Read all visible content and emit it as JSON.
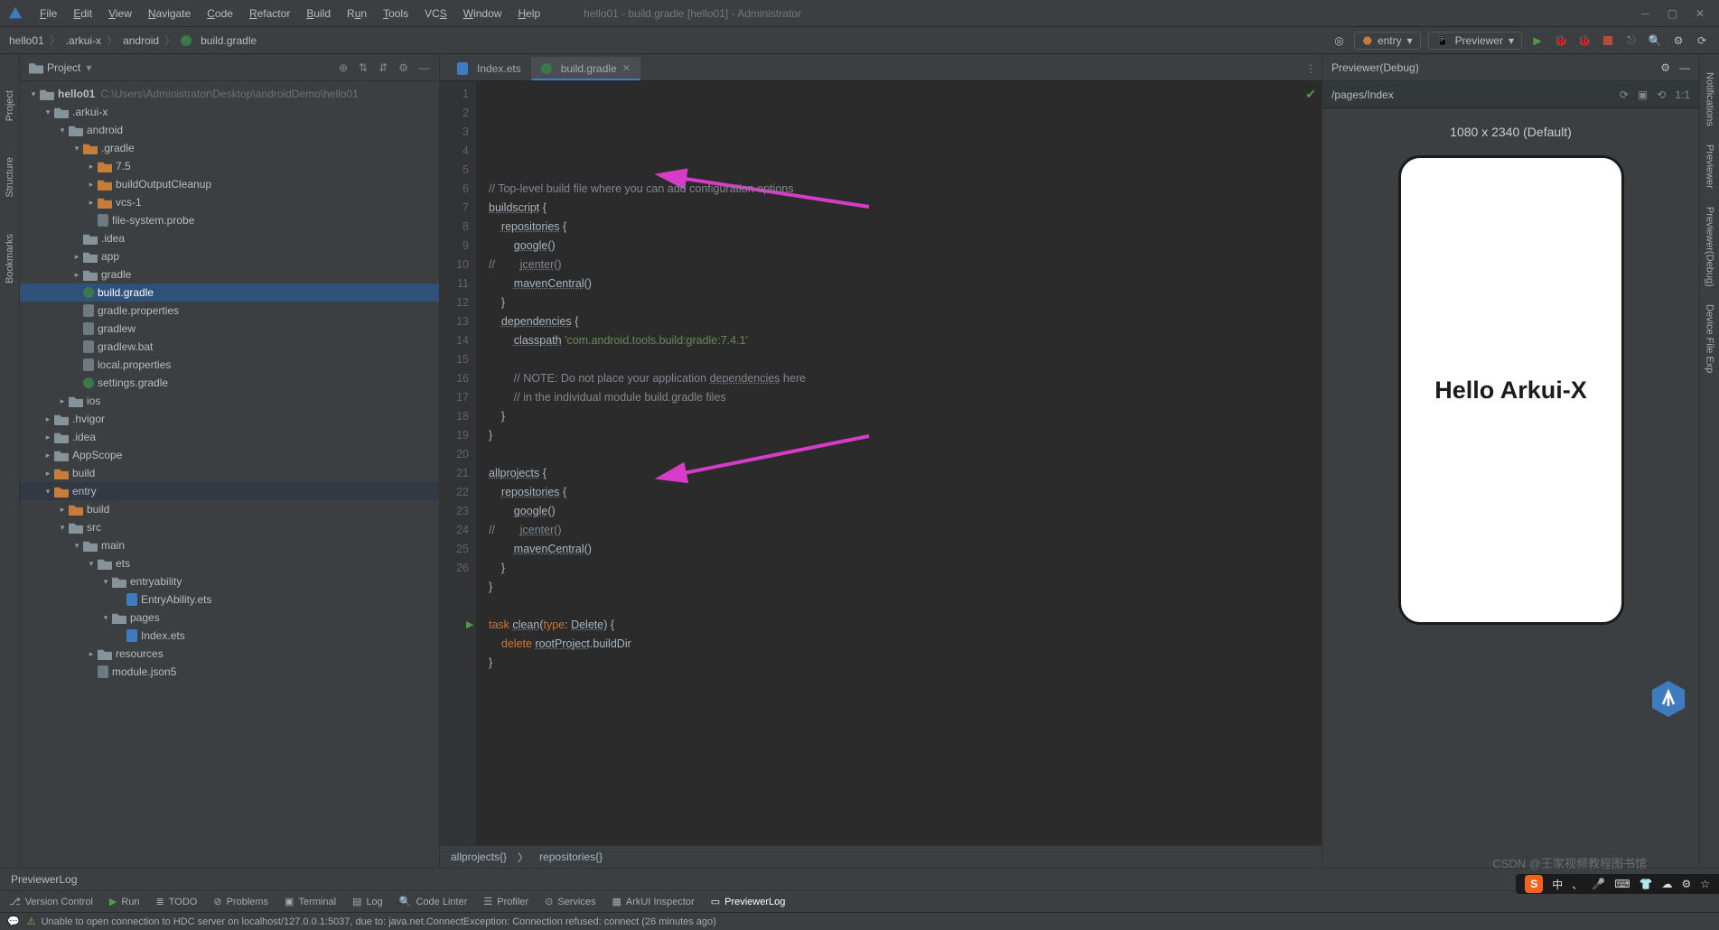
{
  "window": {
    "title": "hello01 - build.gradle [hello01] - Administrator"
  },
  "menu": [
    "File",
    "Edit",
    "View",
    "Navigate",
    "Code",
    "Refactor",
    "Build",
    "Run",
    "Tools",
    "VCS",
    "Window",
    "Help"
  ],
  "breadcrumb": [
    "hello01",
    ".arkui-x",
    "android",
    "build.gradle"
  ],
  "runConfig": {
    "entry": "entry",
    "previewer": "Previewer"
  },
  "project": {
    "label": "Project",
    "rootName": "hello01",
    "rootPath": "C:\\Users\\Administrator\\Desktop\\androidDemo\\hello01",
    "tree": [
      ".arkui-x",
      "android",
      ".gradle",
      "7.5",
      "buildOutputCleanup",
      "vcs-1",
      "file-system.probe",
      ".idea",
      "app",
      "gradle",
      "build.gradle",
      "gradle.properties",
      "gradlew",
      "gradlew.bat",
      "local.properties",
      "settings.gradle",
      "ios",
      ".hvigor",
      ".idea",
      "AppScope",
      "build",
      "entry",
      "build",
      "src",
      "main",
      "ets",
      "entryability",
      "EntryAbility.ets",
      "pages",
      "Index.ets",
      "resources",
      "module.json5"
    ]
  },
  "tabs": [
    {
      "icon": "ets",
      "label": "Index.ets",
      "active": false
    },
    {
      "icon": "gradle",
      "label": "build.gradle",
      "active": true
    }
  ],
  "code": {
    "lines": [
      "// Top-level build file where you can add configuration options ",
      "buildscript {",
      "    repositories {",
      "        google()",
      "//        jcenter()",
      "        mavenCentral()",
      "    }",
      "    dependencies {",
      "        classpath 'com.android.tools.build:gradle:7.4.1'",
      "",
      "        // NOTE: Do not place your application dependencies here",
      "        // in the individual module build.gradle files",
      "    }",
      "}",
      "",
      "allprojects {",
      "    repositories {",
      "        google()",
      "//        jcenter()",
      "        mavenCentral()",
      "    }",
      "}",
      "",
      "task clean(type: Delete) {",
      "    delete rootProject.buildDir",
      "}"
    ]
  },
  "editorCrumb": [
    "allprojects{}",
    "repositories{}"
  ],
  "previewer": {
    "header": "Previewer(Debug)",
    "page": "/pages/Index",
    "deviceLabel": "1080 x 2340 (Default)",
    "appText": "Hello Arkui-X"
  },
  "leftRail": [
    "Project",
    "Structure",
    "Bookmarks"
  ],
  "rightRail": [
    "Notifications",
    "Previewer",
    "Previewer(Debug)",
    "Device File Exp"
  ],
  "previewerLog": "PreviewerLog",
  "bottomToolbar": [
    "Version Control",
    "Run",
    "TODO",
    "Problems",
    "Terminal",
    "Log",
    "Code Linter",
    "Profiler",
    "Services",
    "ArkUI Inspector",
    "PreviewerLog"
  ],
  "statusbar": {
    "message": "Unable to open connection to HDC server on localhost/127.0.0.1:5037, due to: java.net.ConnectException: Connection refused: connect (26 minutes ago)"
  },
  "watermark": "CSDN @王家视频教程图书馆",
  "tray": [
    "中",
    "、",
    "🎤",
    "⌨",
    "👕",
    "☁",
    "⚙",
    "☆"
  ]
}
